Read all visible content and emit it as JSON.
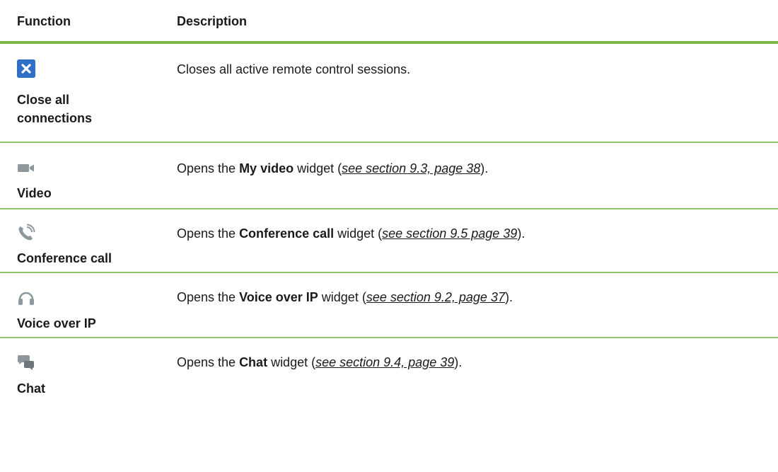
{
  "table": {
    "headers": {
      "function": "Function",
      "description": "Description"
    },
    "colors": {
      "rule": "#7ab648",
      "row_rule": "#92c46a",
      "close_icon_bg": "#2f6fc7"
    },
    "rows": [
      {
        "icon": "close-x-icon",
        "name_line1": "Close all",
        "name_line2": "connections",
        "desc_text": "Closes all active remote control sessions."
      },
      {
        "icon": "video-camera-icon",
        "name": "Video",
        "desc_pre": "Opens the ",
        "desc_bold": "My video",
        "desc_mid": " widget (",
        "desc_link": "see section 9.3, page 38",
        "desc_post": ")."
      },
      {
        "icon": "phone-call-icon",
        "name": "Conference call",
        "desc_pre": "Opens the ",
        "desc_bold": "Conference call",
        "desc_mid": " widget (",
        "desc_link": "see section 9.5 page 39",
        "desc_post": ")."
      },
      {
        "icon": "headset-icon",
        "name": "Voice over IP",
        "desc_pre": "Opens the ",
        "desc_bold": "Voice over IP",
        "desc_mid": " widget (",
        "desc_link": "see section 9.2, page 37",
        "desc_post": ")."
      },
      {
        "icon": "chat-bubbles-icon",
        "name": "Chat",
        "desc_pre": "Opens the ",
        "desc_bold": "Chat",
        "desc_mid": " widget (",
        "desc_link": "see section 9.4, page 39",
        "desc_post": ")."
      }
    ]
  }
}
